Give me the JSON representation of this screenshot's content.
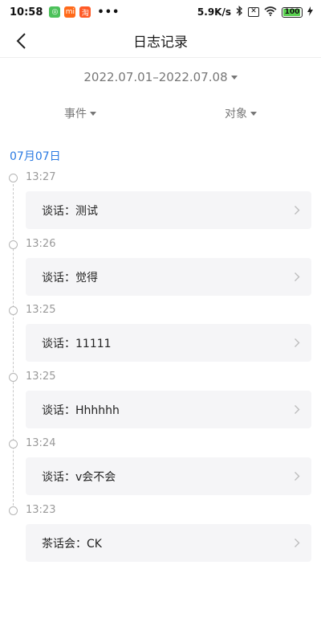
{
  "status_bar": {
    "time": "10:58",
    "apps": [
      {
        "icon": "wechat-icon",
        "glyph": "◎",
        "color": "#4cc15a"
      },
      {
        "icon": "mi-icon",
        "glyph": "mi",
        "color": "#ff6a1a"
      },
      {
        "icon": "taobao-icon",
        "glyph": "淘",
        "color": "#ff5a26"
      }
    ],
    "more": "•••",
    "network_speed": "5.9K/s",
    "sim_indicator": "✕",
    "battery": "100"
  },
  "header": {
    "title": "日志记录",
    "back_icon": "chevron-left-icon"
  },
  "date_range": {
    "label": "2022.07.01–2022.07.08"
  },
  "filters": [
    {
      "label": "事件"
    },
    {
      "label": "对象"
    }
  ],
  "timeline": {
    "date_heading": "07月07日",
    "accent": "#2a7ae2",
    "entries": [
      {
        "time": "13:27",
        "text": "谈话：测试"
      },
      {
        "time": "13:26",
        "text": "谈话：觉得"
      },
      {
        "time": "13:25",
        "text": "谈话：11111"
      },
      {
        "time": "13:25",
        "text": "谈话：Hhhhhh"
      },
      {
        "time": "13:24",
        "text": "谈话：v会不会"
      },
      {
        "time": "13:23",
        "text": "茶话会：CK"
      }
    ]
  }
}
